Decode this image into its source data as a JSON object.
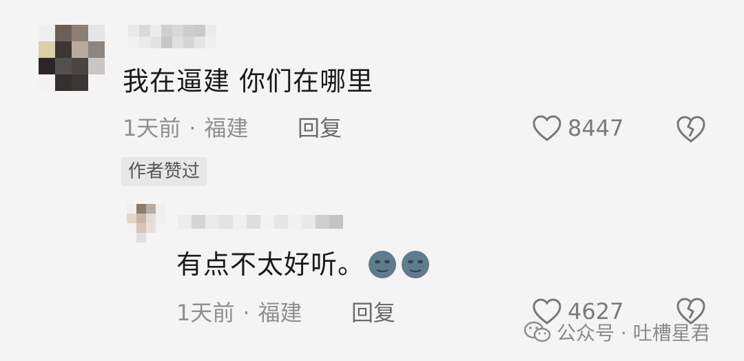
{
  "comment": {
    "text": "我在逼建 你们在哪里",
    "time": "1天前",
    "separator": "·",
    "location": "福建",
    "reply_label": "回复",
    "like_count": "8447",
    "author_liked_label": "作者赞过"
  },
  "reply": {
    "text": "有点不太好听。",
    "time": "1天前",
    "separator": "·",
    "location": "福建",
    "reply_label": "回复",
    "like_count": "4627"
  },
  "watermark": {
    "text": "公众号 · 吐槽星君"
  },
  "icons": {
    "like": "heart-icon",
    "dislike": "broken-heart-icon",
    "emoji": "new-moon-face-icon",
    "watermark": "wechat-icon"
  }
}
